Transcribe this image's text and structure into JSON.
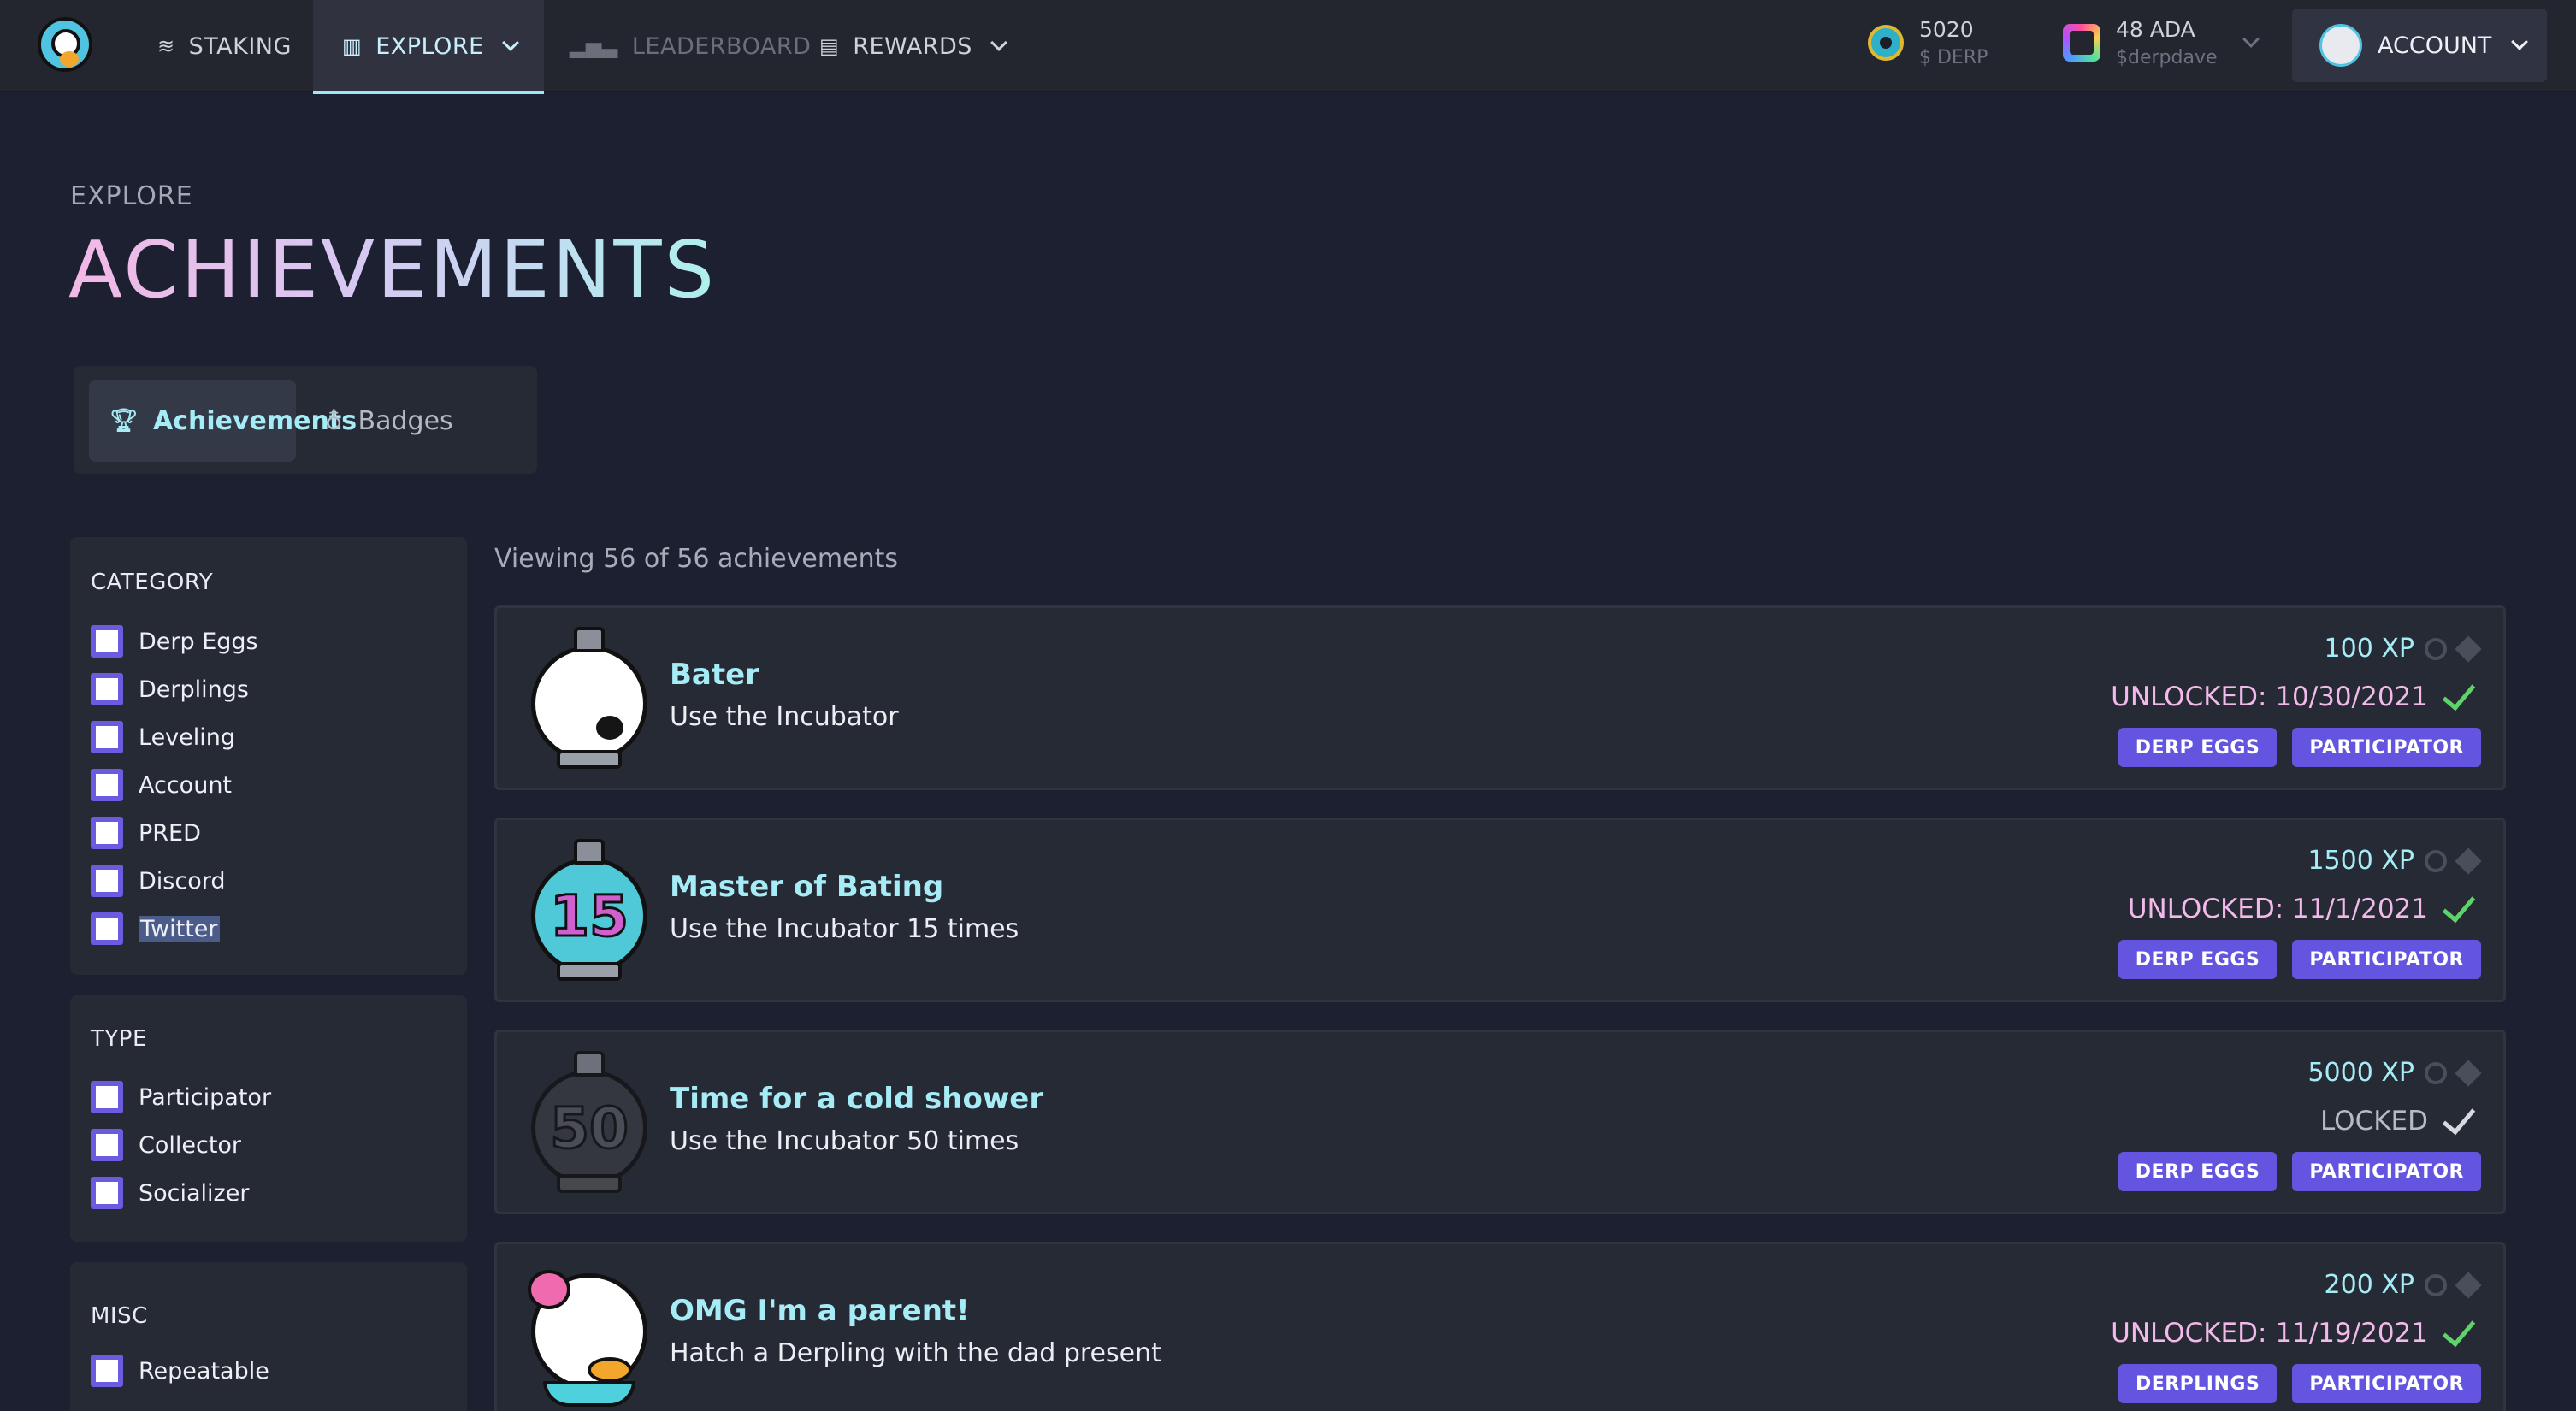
{
  "nav": {
    "items": [
      {
        "label": "STAKING",
        "icon": "layers-icon"
      },
      {
        "label": "EXPLORE",
        "icon": "map-icon",
        "active": true
      },
      {
        "label": "LEADERBOARD",
        "icon": "bar-chart-icon"
      },
      {
        "label": "REWARDS",
        "icon": "gift-icon"
      }
    ],
    "derp_balance": "5020",
    "derp_unit": "$ DERP",
    "ada_balance": "48 ADA",
    "ada_handle": "$derpdave",
    "account_label": "ACCOUNT"
  },
  "header": {
    "breadcrumb": "EXPLORE",
    "title": "ACHIEVEMENTS"
  },
  "tabs": [
    {
      "label": "Achievements",
      "selected": true
    },
    {
      "label": "Badges",
      "selected": false
    }
  ],
  "filters": {
    "category": {
      "title": "CATEGORY",
      "options": [
        "Derp Eggs",
        "Derplings",
        "Leveling",
        "Account",
        "PRED",
        "Discord",
        "Twitter"
      ]
    },
    "type": {
      "title": "TYPE",
      "options": [
        "Participator",
        "Collector",
        "Socializer"
      ]
    },
    "misc": {
      "title": "MISC",
      "options": [
        "Repeatable"
      ]
    }
  },
  "list": {
    "viewing_text": "Viewing 56 of 56 achievements",
    "achievements": [
      {
        "name": "Bater",
        "description": "Use the Incubator",
        "xp": "100 XP",
        "status": "UNLOCKED: 10/30/2021",
        "tags": [
          "DERP EGGS",
          "PARTICIPATOR"
        ]
      },
      {
        "name": "Master of Bating",
        "description": "Use the Incubator 15 times",
        "xp": "1500 XP",
        "status": "UNLOCKED: 11/1/2021",
        "tags": [
          "DERP EGGS",
          "PARTICIPATOR"
        ],
        "badge_text": "15"
      },
      {
        "name": "Time for a cold shower",
        "description": "Use the Incubator 50 times",
        "xp": "5000 XP",
        "status": "LOCKED",
        "tags": [
          "DERP EGGS",
          "PARTICIPATOR"
        ],
        "badge_text": "50"
      },
      {
        "name": "OMG I'm a parent!",
        "description": "Hatch a Derpling with the dad present",
        "xp": "200 XP",
        "status": "UNLOCKED: 11/19/2021",
        "tags": [
          "DERPLINGS",
          "PARTICIPATOR"
        ]
      }
    ]
  },
  "colors": {
    "accent": "#a6ecf6",
    "tag": "#6455e0",
    "unlocked": "#f2b9ea",
    "check": "#5ed36a"
  }
}
